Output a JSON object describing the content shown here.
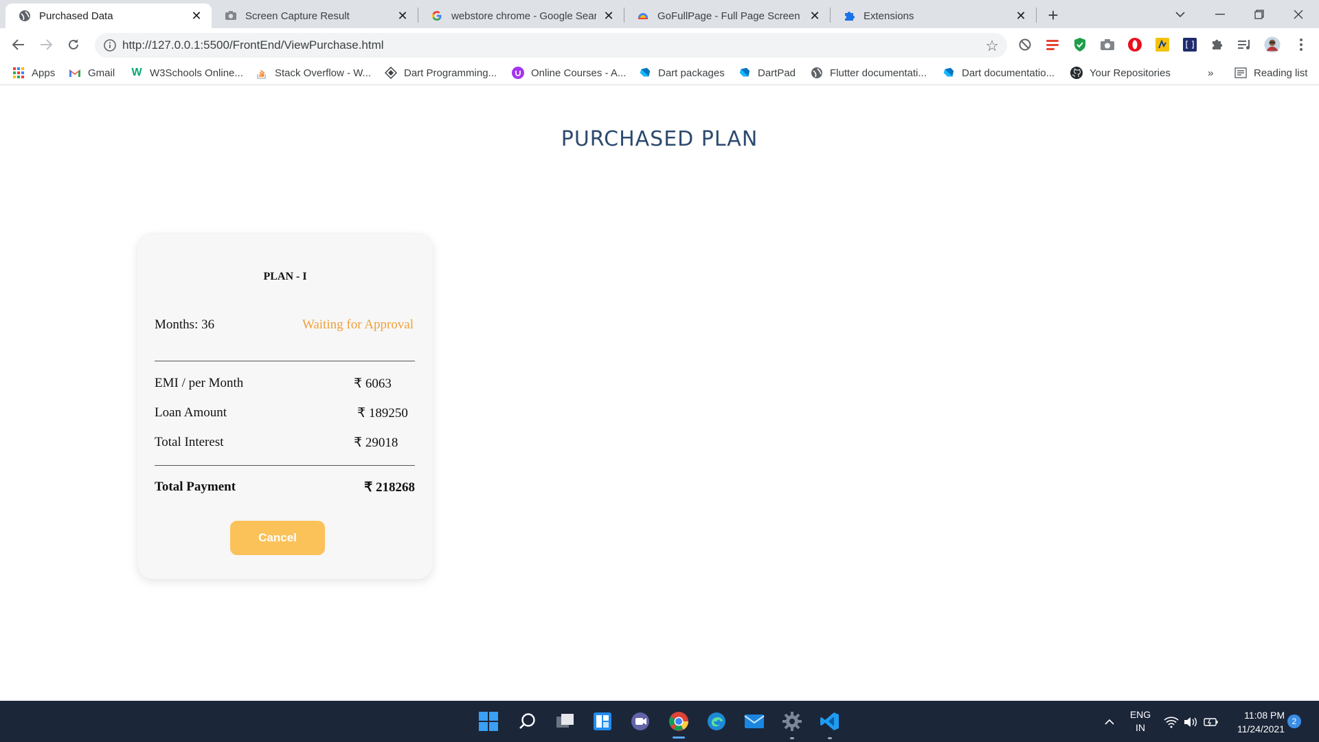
{
  "browser": {
    "tabs": [
      {
        "title": "Purchased Data",
        "icon": "globe-icon",
        "active": true
      },
      {
        "title": "Screen Capture Result",
        "icon": "camera-icon",
        "active": false
      },
      {
        "title": "webstore chrome - Google Search",
        "icon": "google-icon",
        "active": false
      },
      {
        "title": "GoFullPage - Full Page Screen Capture",
        "icon": "gofullpage-icon",
        "active": false
      },
      {
        "title": "Extensions",
        "icon": "puzzle-icon",
        "active": false
      }
    ],
    "url": "http://127.0.0.1:5500/FrontEnd/ViewPurchase.html",
    "bookmarks": [
      {
        "label": "Apps",
        "icon": "apps-grid-icon"
      },
      {
        "label": "Gmail",
        "icon": "gmail-icon"
      },
      {
        "label": "W3Schools Online...",
        "icon": "w3schools-icon"
      },
      {
        "label": "Stack Overflow - W...",
        "icon": "stackoverflow-icon"
      },
      {
        "label": "Dart Programming...",
        "icon": "dart-programming-icon"
      },
      {
        "label": "Online Courses - A...",
        "icon": "udemy-icon"
      },
      {
        "label": "Dart packages",
        "icon": "dart-icon"
      },
      {
        "label": "DartPad",
        "icon": "dart-icon"
      },
      {
        "label": "Flutter documentati...",
        "icon": "globe-icon"
      },
      {
        "label": "Dart documentatio...",
        "icon": "dart-icon"
      },
      {
        "label": "Your Repositories",
        "icon": "github-icon"
      }
    ],
    "bookmarks_overflow": "»",
    "reading_list": "Reading list"
  },
  "page": {
    "title": "PURCHASED PLAN",
    "plan": {
      "name": "PLAN - I",
      "months_label": "Months: 36",
      "status": "Waiting for Approval",
      "rows": [
        {
          "label": "EMI / per Month",
          "value": "₹ 6063"
        },
        {
          "label": "Loan Amount",
          "value": "₹ 189250"
        },
        {
          "label": "Total Interest",
          "value": "₹ 29018"
        }
      ],
      "total": {
        "label": "Total Payment",
        "value": "₹ 218268"
      },
      "cancel_label": "Cancel"
    }
  },
  "taskbar": {
    "lang_top": "ENG",
    "lang_bottom": "IN",
    "time": "11:08 PM",
    "date": "11/24/2021",
    "notifications": "2"
  },
  "colors": {
    "title": "#2c4a6e",
    "status": "#f0a13a",
    "cancel_button": "#fbc25a",
    "taskbar": "#1c2639"
  }
}
